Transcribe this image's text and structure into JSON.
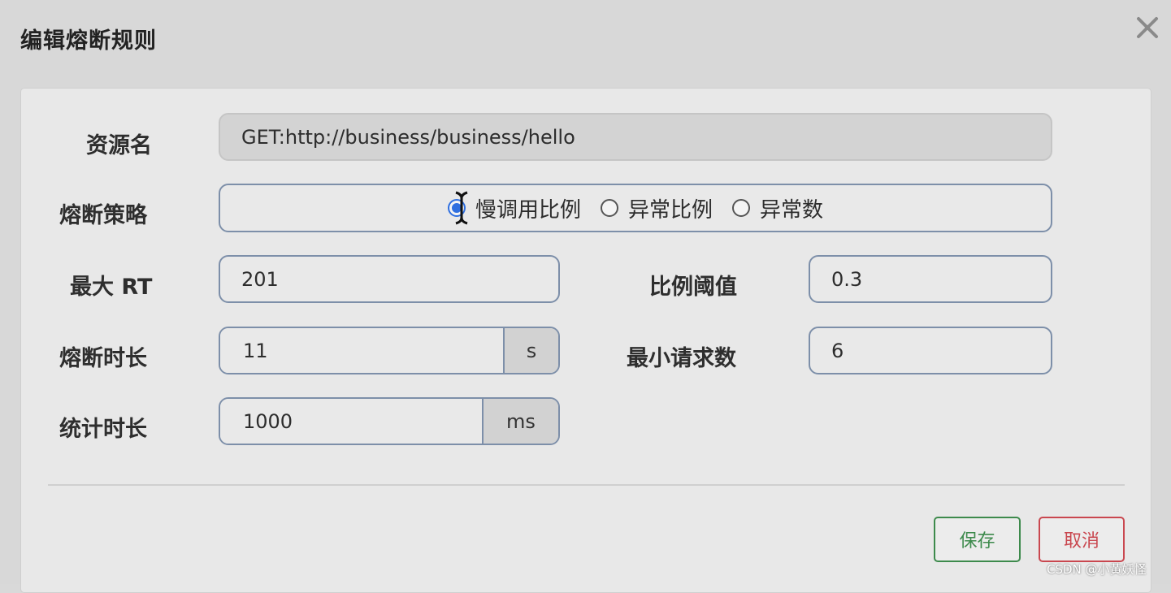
{
  "dialog": {
    "title": "编辑熔断规则",
    "close_icon": "close-icon"
  },
  "form": {
    "resource": {
      "label": "资源名",
      "value": "GET:http://business/business/hello"
    },
    "strategy": {
      "label": "熔断策略",
      "options": [
        {
          "label": "慢调用比例",
          "checked": true
        },
        {
          "label": "异常比例",
          "checked": false
        },
        {
          "label": "异常数",
          "checked": false
        }
      ]
    },
    "max_rt": {
      "label": "最大 RT",
      "value": "201"
    },
    "ratio_threshold": {
      "label": "比例阈值",
      "value": "0.3"
    },
    "break_duration": {
      "label": "熔断时长",
      "value": "11",
      "unit": "s"
    },
    "min_requests": {
      "label": "最小请求数",
      "value": "6"
    },
    "stat_duration": {
      "label": "统计时长",
      "value": "1000",
      "unit": "ms"
    }
  },
  "footer": {
    "save_label": "保存",
    "cancel_label": "取消"
  },
  "watermark": "CSDN @小黄妖怪",
  "colors": {
    "accent_blue": "#2f6fe0",
    "save_green": "#3d8a4c",
    "cancel_red": "#c9474f",
    "field_border": "#7d8fa9"
  }
}
